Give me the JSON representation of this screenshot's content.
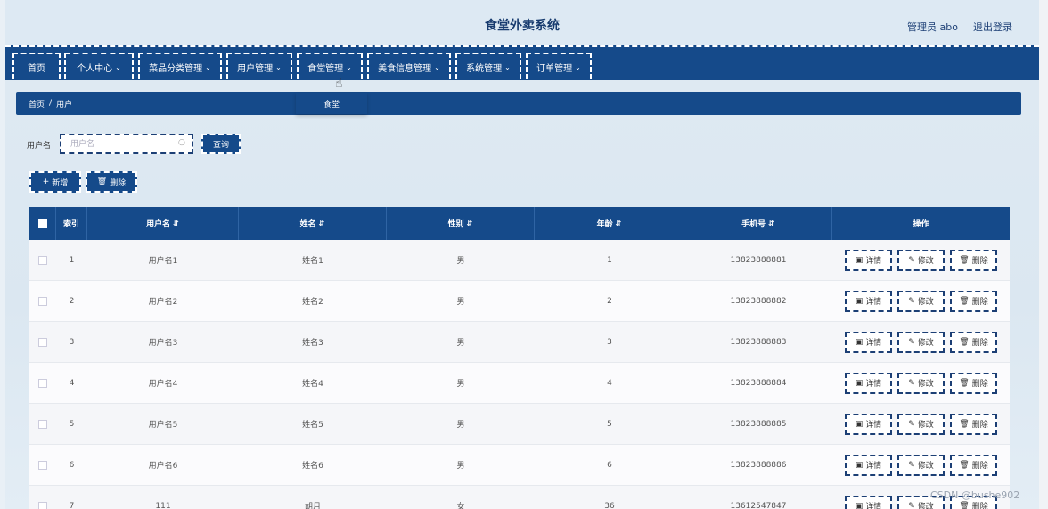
{
  "app": {
    "title": "食堂外卖系统",
    "admin_label": "管理员 abo",
    "logout_label": "退出登录"
  },
  "nav": {
    "items": [
      {
        "label": "首页",
        "has_dropdown": false
      },
      {
        "label": "个人中心",
        "has_dropdown": true
      },
      {
        "label": "菜品分类管理",
        "has_dropdown": true
      },
      {
        "label": "用户管理",
        "has_dropdown": true
      },
      {
        "label": "食堂管理",
        "has_dropdown": true
      },
      {
        "label": "美食信息管理",
        "has_dropdown": true
      },
      {
        "label": "系统管理",
        "has_dropdown": true
      },
      {
        "label": "订单管理",
        "has_dropdown": true
      }
    ],
    "dropdown_item": "食堂"
  },
  "breadcrumb": {
    "home": "首页",
    "separator": "/",
    "current": "用户"
  },
  "search": {
    "label": "用户名",
    "placeholder": "用户名",
    "query_button": "查询"
  },
  "toolbar": {
    "add_label": "新增",
    "delete_label": "删除"
  },
  "table": {
    "headers": {
      "index": "索引",
      "username": "用户名",
      "name": "姓名",
      "gender": "性别",
      "age": "年龄",
      "phone": "手机号",
      "actions": "操作"
    },
    "action_labels": {
      "detail": "详情",
      "edit": "修改",
      "delete": "删除"
    },
    "rows": [
      {
        "index": "1",
        "username": "用户名1",
        "name": "姓名1",
        "gender": "男",
        "age": "1",
        "phone": "13823888881"
      },
      {
        "index": "2",
        "username": "用户名2",
        "name": "姓名2",
        "gender": "男",
        "age": "2",
        "phone": "13823888882"
      },
      {
        "index": "3",
        "username": "用户名3",
        "name": "姓名3",
        "gender": "男",
        "age": "3",
        "phone": "13823888883"
      },
      {
        "index": "4",
        "username": "用户名4",
        "name": "姓名4",
        "gender": "男",
        "age": "4",
        "phone": "13823888884"
      },
      {
        "index": "5",
        "username": "用户名5",
        "name": "姓名5",
        "gender": "男",
        "age": "5",
        "phone": "13823888885"
      },
      {
        "index": "6",
        "username": "用户名6",
        "name": "姓名6",
        "gender": "男",
        "age": "6",
        "phone": "13823888886"
      },
      {
        "index": "7",
        "username": "111",
        "name": "胡月",
        "gender": "女",
        "age": "36",
        "phone": "13612547847"
      }
    ]
  },
  "watermark": "CSDN @bushe902",
  "colors": {
    "primary": "#154a8a",
    "title": "#163a6e"
  }
}
